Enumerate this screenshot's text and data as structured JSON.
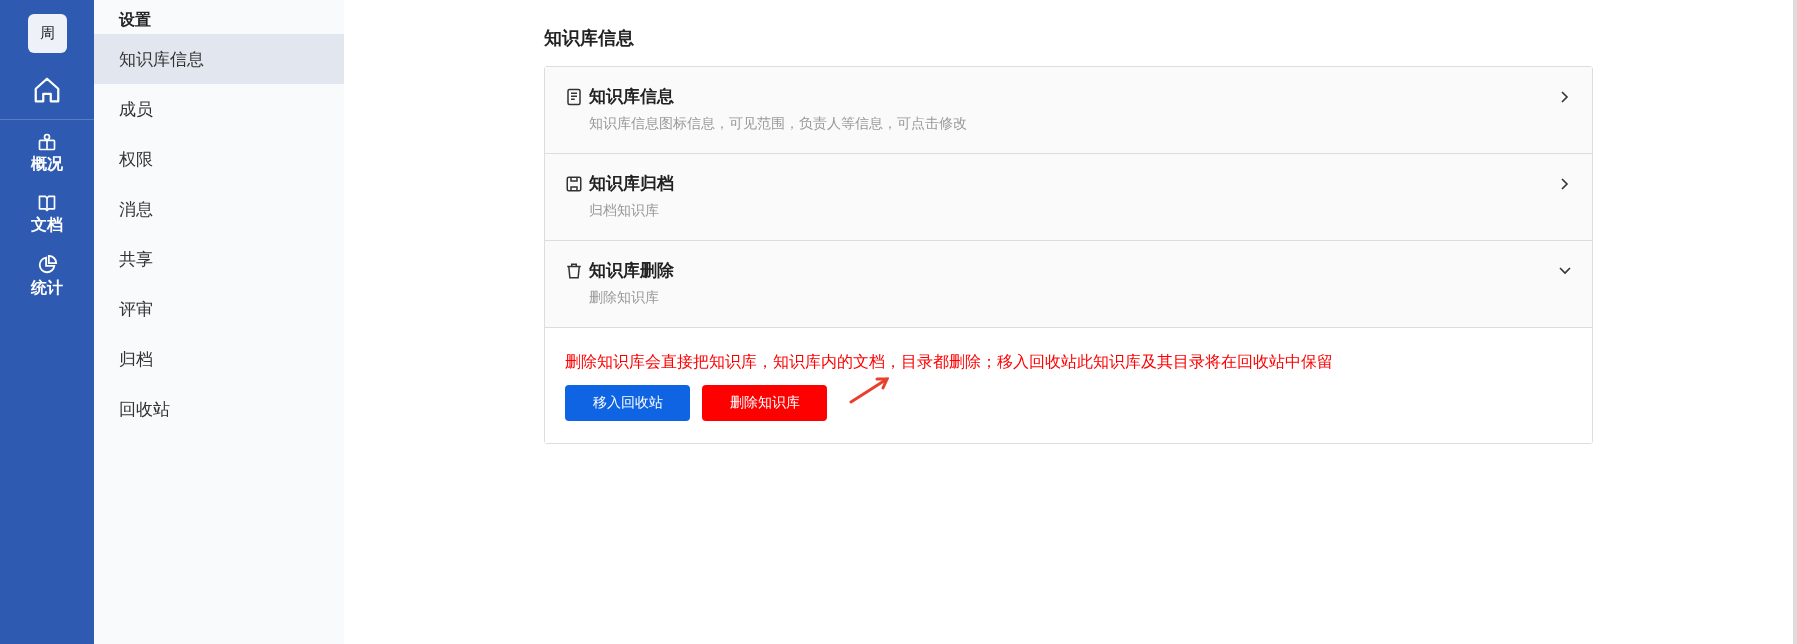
{
  "rail": {
    "avatar": "周",
    "items": [
      {
        "kind": "overview",
        "label": "概况"
      },
      {
        "kind": "docs",
        "label": "文档"
      },
      {
        "kind": "stats",
        "label": "统计"
      }
    ]
  },
  "settings_nav": {
    "title": "设置",
    "items": [
      {
        "label": "知识库信息",
        "selected": true
      },
      {
        "label": "成员",
        "selected": false
      },
      {
        "label": "权限",
        "selected": false
      },
      {
        "label": "消息",
        "selected": false
      },
      {
        "label": "共享",
        "selected": false
      },
      {
        "label": "评审",
        "selected": false
      },
      {
        "label": "归档",
        "selected": false
      },
      {
        "label": "回收站",
        "selected": false
      }
    ]
  },
  "page_title": "知识库信息",
  "sections": [
    {
      "kind": "info",
      "title": "知识库信息",
      "description": "知识库信息图标信息，可见范围，负责人等信息，可点击修改",
      "expanded": false
    },
    {
      "kind": "archive",
      "title": "知识库归档",
      "description": "归档知识库",
      "expanded": false
    },
    {
      "kind": "delete",
      "title": "知识库删除",
      "description": "删除知识库",
      "expanded": true,
      "warning": "删除知识库会直接把知识库，知识库内的文档，目录都删除；移入回收站此知识库及其目录将在回收站中保留",
      "buttons": [
        {
          "kind": "primary",
          "label": "移入回收站"
        },
        {
          "kind": "danger",
          "label": "删除知识库"
        }
      ]
    }
  ]
}
